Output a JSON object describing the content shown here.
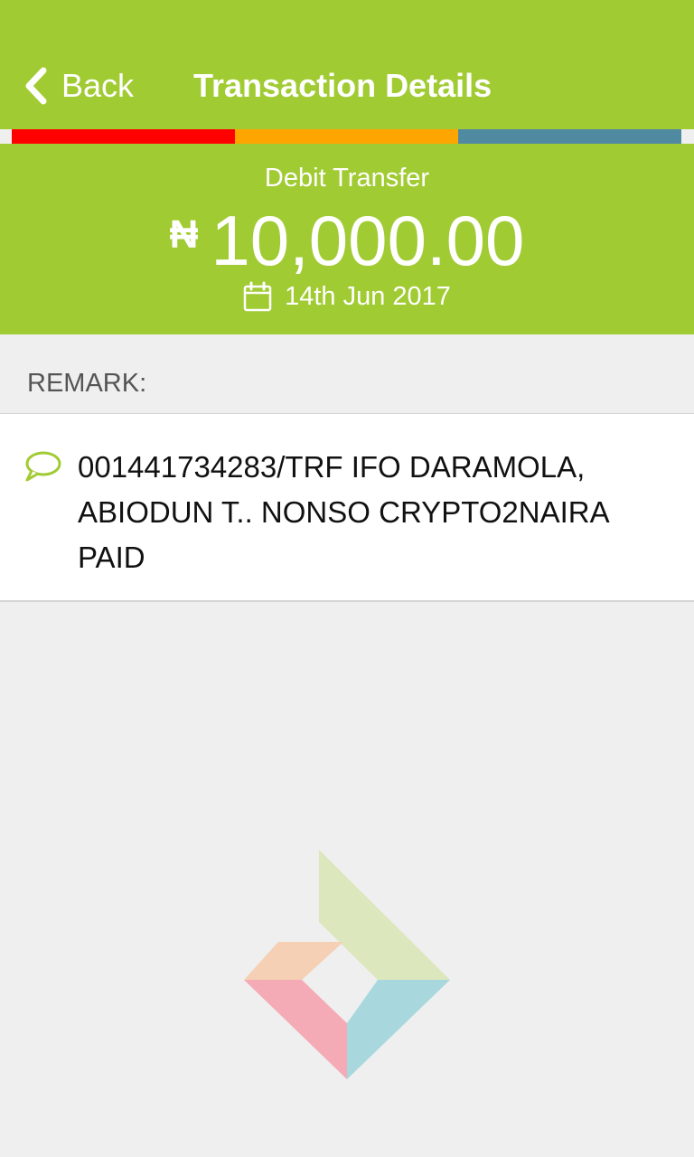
{
  "header": {
    "back_label": "Back",
    "title": "Transaction Details",
    "back_icon": "chevron-left-icon"
  },
  "colors": {
    "brand_green": "#a1cb33",
    "stripe": [
      "#ff0000",
      "#ffa500",
      "#508aa0"
    ]
  },
  "transaction": {
    "type": "Debit Transfer",
    "currency_symbol": "₦",
    "amount": "10,000.00",
    "date": "14th Jun 2017",
    "date_icon": "calendar-icon"
  },
  "remark": {
    "label": "REMARK:",
    "icon": "speech-bubble-icon",
    "text": "001441734283/TRF IFO DARAMOLA, ABIODUN T.. NONSO CRYPTO2NAIRA PAID"
  },
  "footer": {
    "logo": "brand-logo"
  }
}
